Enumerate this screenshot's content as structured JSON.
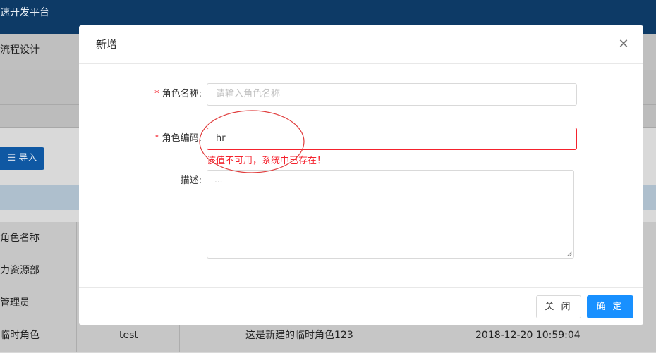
{
  "background": {
    "app_title": "速开发平台",
    "menu_text": "流程设计",
    "import_button": "导入",
    "table_column_role_name": "角色名称",
    "rows": [
      {
        "name": "力资源部",
        "code": "",
        "desc": "",
        "time": ""
      },
      {
        "name": "管理员",
        "code": "",
        "desc": "",
        "time": ""
      },
      {
        "name": "临时角色",
        "code": "test",
        "desc": "这是新建的临时角色123",
        "time": "2018-12-20 10:59:04"
      }
    ]
  },
  "modal": {
    "title": "新增",
    "fields": {
      "role_name": {
        "label": "角色名称:",
        "placeholder": "请输入角色名称",
        "value": ""
      },
      "role_code": {
        "label": "角色编码:",
        "value": "hr",
        "error": "该值不可用，系统中已存在！"
      },
      "description": {
        "label": "描述:",
        "placeholder": "..."
      }
    },
    "buttons": {
      "close": "关 闭",
      "ok": "确 定"
    }
  },
  "colors": {
    "primary": "#1890ff",
    "error": "#f5222d",
    "header": "#0d3a66"
  },
  "icons": {
    "close": "close-icon",
    "required": "asterisk-icon"
  }
}
